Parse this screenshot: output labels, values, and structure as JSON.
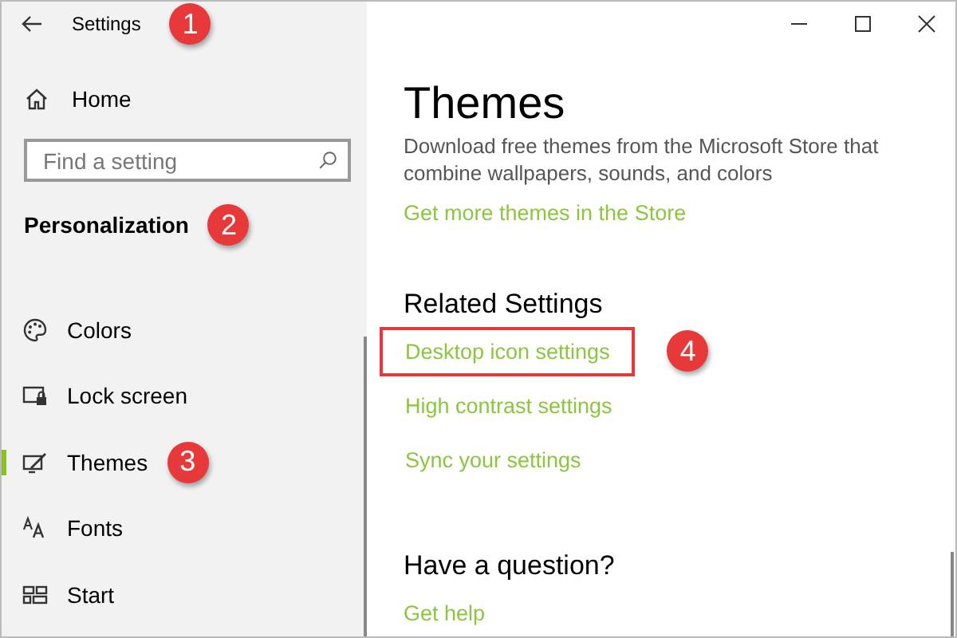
{
  "window": {
    "title": "Settings",
    "title_callout": "1"
  },
  "sidebar": {
    "home": "Home",
    "search": {
      "placeholder": "Find a setting"
    },
    "heading": "Personalization",
    "heading_callout": "2",
    "items": [
      {
        "label": "Colors",
        "kind": "palette",
        "selected": false
      },
      {
        "label": "Lock screen",
        "kind": "lock",
        "selected": false
      },
      {
        "label": "Themes",
        "kind": "themes",
        "selected": true,
        "callout": "3"
      },
      {
        "label": "Fonts",
        "kind": "fonts",
        "selected": false
      },
      {
        "label": "Start",
        "kind": "start",
        "selected": false
      }
    ]
  },
  "main": {
    "title": "Themes",
    "description": "Download free themes from the Microsoft Store that combine wallpapers, sounds, and colors",
    "store_link": "Get more themes in the Store",
    "related_heading": "Related Settings",
    "related_links": [
      {
        "label": "Desktop icon settings",
        "highlighted": true,
        "callout": "4"
      },
      {
        "label": "High contrast settings",
        "highlighted": false
      },
      {
        "label": "Sync your settings",
        "highlighted": false
      }
    ],
    "question_heading": "Have a question?",
    "help_link": "Get help"
  }
}
